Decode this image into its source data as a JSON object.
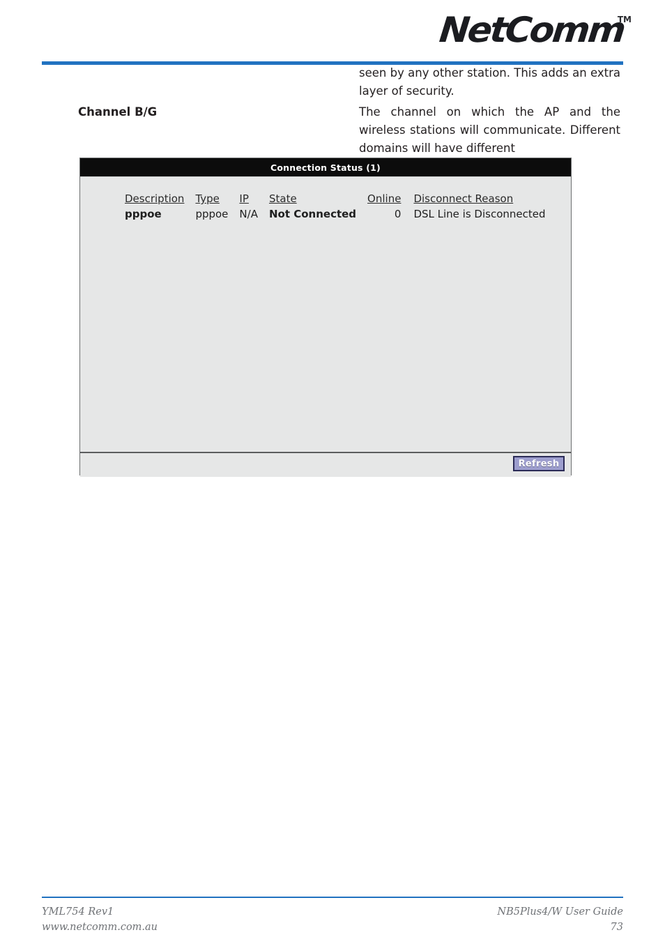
{
  "header": {
    "brand": "NetComm",
    "trademark": "TM"
  },
  "content": {
    "intro_paragraph": "seen by any other station.  This adds an extra layer of security.",
    "term_label": "Channel B/G",
    "term_description": "The channel on which the AP and the wireless stations will communicate. Different domains will have different"
  },
  "panel": {
    "title": "Connection Status (1)",
    "table": {
      "columns": [
        "Description",
        "Type",
        "IP",
        "State",
        "Online",
        "Disconnect Reason"
      ],
      "rows": [
        {
          "description": "pppoe",
          "type": "pppoe",
          "ip": "N/A",
          "state": "Not Connected",
          "online": "0",
          "disconnect_reason": "DSL Line is Disconnected"
        }
      ]
    },
    "refresh_label": "Refresh"
  },
  "footer": {
    "doc_code": "YML754 Rev1",
    "website": "www.netcomm.com.au",
    "guide_title": "NB5Plus4/W User Guide",
    "page_number": "73"
  },
  "colors": {
    "accent_blue": "#2172c0",
    "panel_bg": "#e6e7e7",
    "titlebar_bg": "#0c0c0c",
    "refresh_fill": "#9d9ece",
    "refresh_border": "#2b2b57"
  }
}
